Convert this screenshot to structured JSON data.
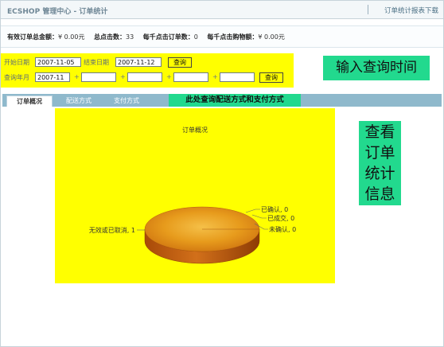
{
  "header": {
    "title": "ECSHOP 管理中心 - 订单统计",
    "download_link": "订单统计报表下载"
  },
  "summary": [
    {
      "label": "有效订单总金额：",
      "value": "¥ 0.00元"
    },
    {
      "label": "总点击数：",
      "value": "33"
    },
    {
      "label": "每千点击订单数：",
      "value": "0"
    },
    {
      "label": "每千点击购物额：",
      "value": "¥ 0.00元"
    }
  ],
  "query": {
    "start_label": "开始日期",
    "start_value": "2007-11-05",
    "end_label": "结束日期",
    "end_value": "2007-11-12",
    "query_button": "查询",
    "month_label": "查询年月",
    "month_values": [
      "2007-11",
      "",
      "",
      "",
      ""
    ],
    "plus": "+",
    "query_button2": "查询"
  },
  "annotations": {
    "query_time": "输入查询时间",
    "tabs_note": "此处查询配送方式和支付方式",
    "view_info": [
      "查看",
      "订单",
      "统计",
      "信息"
    ]
  },
  "tabs": [
    "订单概况",
    "配送方式",
    "支付方式"
  ],
  "colors": {
    "highlight": "#ffff00",
    "annotation": "#22d98e",
    "tab_bar": "#8fb9cc",
    "pie_top": "#e79b1c",
    "pie_side": "#b8540c"
  },
  "chart_data": {
    "type": "pie",
    "title": "订单概况",
    "slices": [
      {
        "label": "无效或已取消",
        "value": 1
      },
      {
        "label": "已确认",
        "value": 0
      },
      {
        "label": "已成交",
        "value": 0
      },
      {
        "label": "未确认",
        "value": 0
      }
    ]
  }
}
